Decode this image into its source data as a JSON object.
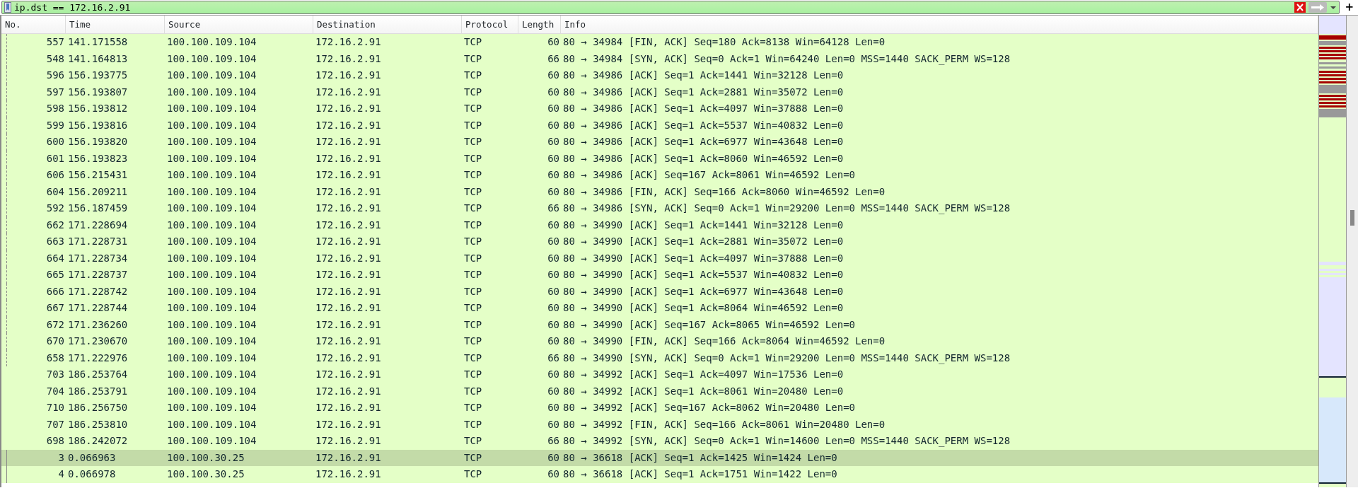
{
  "filter": {
    "value": "ip.dst == 172.16.2.91",
    "valid": true
  },
  "columns": [
    "No.",
    "Time",
    "Source",
    "Destination",
    "Protocol",
    "Length",
    "Info"
  ],
  "rows": [
    {
      "no": "557",
      "time": "141.171558",
      "source": "100.100.109.104",
      "destination": "172.16.2.91",
      "protocol": "TCP",
      "length": "60",
      "info": "80 → 34984 [FIN, ACK] Seq=180 Ack=8138 Win=64128 Len=0",
      "selected": false,
      "related": true,
      "same_conversation": false
    },
    {
      "no": "548",
      "time": "141.164813",
      "source": "100.100.109.104",
      "destination": "172.16.2.91",
      "protocol": "TCP",
      "length": "66",
      "info": "80 → 34984 [SYN, ACK] Seq=0 Ack=1 Win=64240 Len=0 MSS=1440 SACK_PERM WS=128",
      "selected": false,
      "related": true,
      "same_conversation": false
    },
    {
      "no": "596",
      "time": "156.193775",
      "source": "100.100.109.104",
      "destination": "172.16.2.91",
      "protocol": "TCP",
      "length": "60",
      "info": "80 → 34986 [ACK] Seq=1 Ack=1441 Win=32128 Len=0",
      "selected": false,
      "related": true,
      "same_conversation": false
    },
    {
      "no": "597",
      "time": "156.193807",
      "source": "100.100.109.104",
      "destination": "172.16.2.91",
      "protocol": "TCP",
      "length": "60",
      "info": "80 → 34986 [ACK] Seq=1 Ack=2881 Win=35072 Len=0",
      "selected": false,
      "related": true,
      "same_conversation": false
    },
    {
      "no": "598",
      "time": "156.193812",
      "source": "100.100.109.104",
      "destination": "172.16.2.91",
      "protocol": "TCP",
      "length": "60",
      "info": "80 → 34986 [ACK] Seq=1 Ack=4097 Win=37888 Len=0",
      "selected": false,
      "related": true,
      "same_conversation": false
    },
    {
      "no": "599",
      "time": "156.193816",
      "source": "100.100.109.104",
      "destination": "172.16.2.91",
      "protocol": "TCP",
      "length": "60",
      "info": "80 → 34986 [ACK] Seq=1 Ack=5537 Win=40832 Len=0",
      "selected": false,
      "related": true,
      "same_conversation": false
    },
    {
      "no": "600",
      "time": "156.193820",
      "source": "100.100.109.104",
      "destination": "172.16.2.91",
      "protocol": "TCP",
      "length": "60",
      "info": "80 → 34986 [ACK] Seq=1 Ack=6977 Win=43648 Len=0",
      "selected": false,
      "related": true,
      "same_conversation": false
    },
    {
      "no": "601",
      "time": "156.193823",
      "source": "100.100.109.104",
      "destination": "172.16.2.91",
      "protocol": "TCP",
      "length": "60",
      "info": "80 → 34986 [ACK] Seq=1 Ack=8060 Win=46592 Len=0",
      "selected": false,
      "related": true,
      "same_conversation": false
    },
    {
      "no": "606",
      "time": "156.215431",
      "source": "100.100.109.104",
      "destination": "172.16.2.91",
      "protocol": "TCP",
      "length": "60",
      "info": "80 → 34986 [ACK] Seq=167 Ack=8061 Win=46592 Len=0",
      "selected": false,
      "related": true,
      "same_conversation": false
    },
    {
      "no": "604",
      "time": "156.209211",
      "source": "100.100.109.104",
      "destination": "172.16.2.91",
      "protocol": "TCP",
      "length": "60",
      "info": "80 → 34986 [FIN, ACK] Seq=166 Ack=8060 Win=46592 Len=0",
      "selected": false,
      "related": true,
      "same_conversation": false
    },
    {
      "no": "592",
      "time": "156.187459",
      "source": "100.100.109.104",
      "destination": "172.16.2.91",
      "protocol": "TCP",
      "length": "66",
      "info": "80 → 34986 [SYN, ACK] Seq=0 Ack=1 Win=29200 Len=0 MSS=1440 SACK_PERM WS=128",
      "selected": false,
      "related": true,
      "same_conversation": false
    },
    {
      "no": "662",
      "time": "171.228694",
      "source": "100.100.109.104",
      "destination": "172.16.2.91",
      "protocol": "TCP",
      "length": "60",
      "info": "80 → 34990 [ACK] Seq=1 Ack=1441 Win=32128 Len=0",
      "selected": false,
      "related": true,
      "same_conversation": false
    },
    {
      "no": "663",
      "time": "171.228731",
      "source": "100.100.109.104",
      "destination": "172.16.2.91",
      "protocol": "TCP",
      "length": "60",
      "info": "80 → 34990 [ACK] Seq=1 Ack=2881 Win=35072 Len=0",
      "selected": false,
      "related": true,
      "same_conversation": false
    },
    {
      "no": "664",
      "time": "171.228734",
      "source": "100.100.109.104",
      "destination": "172.16.2.91",
      "protocol": "TCP",
      "length": "60",
      "info": "80 → 34990 [ACK] Seq=1 Ack=4097 Win=37888 Len=0",
      "selected": false,
      "related": true,
      "same_conversation": false
    },
    {
      "no": "665",
      "time": "171.228737",
      "source": "100.100.109.104",
      "destination": "172.16.2.91",
      "protocol": "TCP",
      "length": "60",
      "info": "80 → 34990 [ACK] Seq=1 Ack=5537 Win=40832 Len=0",
      "selected": false,
      "related": true,
      "same_conversation": false
    },
    {
      "no": "666",
      "time": "171.228742",
      "source": "100.100.109.104",
      "destination": "172.16.2.91",
      "protocol": "TCP",
      "length": "60",
      "info": "80 → 34990 [ACK] Seq=1 Ack=6977 Win=43648 Len=0",
      "selected": false,
      "related": true,
      "same_conversation": false
    },
    {
      "no": "667",
      "time": "171.228744",
      "source": "100.100.109.104",
      "destination": "172.16.2.91",
      "protocol": "TCP",
      "length": "60",
      "info": "80 → 34990 [ACK] Seq=1 Ack=8064 Win=46592 Len=0",
      "selected": false,
      "related": true,
      "same_conversation": false
    },
    {
      "no": "672",
      "time": "171.236260",
      "source": "100.100.109.104",
      "destination": "172.16.2.91",
      "protocol": "TCP",
      "length": "60",
      "info": "80 → 34990 [ACK] Seq=167 Ack=8065 Win=46592 Len=0",
      "selected": false,
      "related": true,
      "same_conversation": false
    },
    {
      "no": "670",
      "time": "171.230670",
      "source": "100.100.109.104",
      "destination": "172.16.2.91",
      "protocol": "TCP",
      "length": "60",
      "info": "80 → 34990 [FIN, ACK] Seq=166 Ack=8064 Win=46592 Len=0",
      "selected": false,
      "related": true,
      "same_conversation": false
    },
    {
      "no": "658",
      "time": "171.222976",
      "source": "100.100.109.104",
      "destination": "172.16.2.91",
      "protocol": "TCP",
      "length": "66",
      "info": "80 → 34990 [SYN, ACK] Seq=0 Ack=1 Win=29200 Len=0 MSS=1440 SACK_PERM WS=128",
      "selected": false,
      "related": true,
      "same_conversation": false
    },
    {
      "no": "703",
      "time": "186.253764",
      "source": "100.100.109.104",
      "destination": "172.16.2.91",
      "protocol": "TCP",
      "length": "60",
      "info": "80 → 34992 [ACK] Seq=1 Ack=4097 Win=17536 Len=0",
      "selected": false,
      "related": false,
      "same_conversation": false
    },
    {
      "no": "704",
      "time": "186.253791",
      "source": "100.100.109.104",
      "destination": "172.16.2.91",
      "protocol": "TCP",
      "length": "60",
      "info": "80 → 34992 [ACK] Seq=1 Ack=8061 Win=20480 Len=0",
      "selected": false,
      "related": false,
      "same_conversation": false
    },
    {
      "no": "710",
      "time": "186.256750",
      "source": "100.100.109.104",
      "destination": "172.16.2.91",
      "protocol": "TCP",
      "length": "60",
      "info": "80 → 34992 [ACK] Seq=167 Ack=8062 Win=20480 Len=0",
      "selected": false,
      "related": false,
      "same_conversation": false
    },
    {
      "no": "707",
      "time": "186.253810",
      "source": "100.100.109.104",
      "destination": "172.16.2.91",
      "protocol": "TCP",
      "length": "60",
      "info": "80 → 34992 [FIN, ACK] Seq=166 Ack=8061 Win=20480 Len=0",
      "selected": false,
      "related": false,
      "same_conversation": false
    },
    {
      "no": "698",
      "time": "186.242072",
      "source": "100.100.109.104",
      "destination": "172.16.2.91",
      "protocol": "TCP",
      "length": "66",
      "info": "80 → 34992 [SYN, ACK] Seq=0 Ack=1 Win=14600 Len=0 MSS=1440 SACK_PERM WS=128",
      "selected": false,
      "related": false,
      "same_conversation": false
    },
    {
      "no": "3",
      "time": "0.066963",
      "source": "100.100.30.25",
      "destination": "172.16.2.91",
      "protocol": "TCP",
      "length": "60",
      "info": "80 → 36618 [ACK] Seq=1 Ack=1425 Win=1424 Len=0",
      "selected": true,
      "related": false,
      "same_conversation": true
    },
    {
      "no": "4",
      "time": "0.066978",
      "source": "100.100.30.25",
      "destination": "172.16.2.91",
      "protocol": "TCP",
      "length": "60",
      "info": "80 → 36618 [ACK] Seq=1 Ack=1751 Win=1422 Len=0",
      "selected": false,
      "related": false,
      "same_conversation": true
    }
  ],
  "filter_plus": "+"
}
